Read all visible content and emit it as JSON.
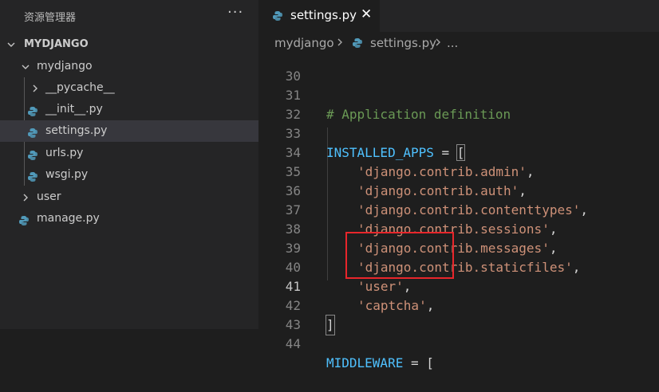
{
  "sidebar": {
    "title": "资源管理器",
    "more_label": "···",
    "project": "MYDJANGO",
    "items": [
      {
        "label": "mydjango",
        "type": "folder"
      },
      {
        "label": "__pycache__",
        "type": "folder"
      },
      {
        "label": "__init__.py",
        "type": "python-file"
      },
      {
        "label": "settings.py",
        "type": "python-file"
      },
      {
        "label": "urls.py",
        "type": "python-file"
      },
      {
        "label": "wsgi.py",
        "type": "python-file"
      },
      {
        "label": "user",
        "type": "folder"
      },
      {
        "label": "manage.py",
        "type": "python-file"
      }
    ]
  },
  "tab": {
    "label": "settings.py",
    "close_label": "✕"
  },
  "breadcrumb": {
    "folder": "mydjango",
    "file": "settings.py",
    "more": "..."
  },
  "editor": {
    "lines": [
      {
        "number": "30",
        "code": ""
      },
      {
        "number": "31",
        "code": "# Application definition"
      },
      {
        "number": "32",
        "code": ""
      },
      {
        "number": "33",
        "code": "INSTALLED_APPS = ["
      },
      {
        "number": "34",
        "code": "'django.contrib.admin',"
      },
      {
        "number": "35",
        "code": "'django.contrib.auth',"
      },
      {
        "number": "36",
        "code": "'django.contrib.contenttypes',"
      },
      {
        "number": "37",
        "code": "'django.contrib.sessions',"
      },
      {
        "number": "38",
        "code": "'django.contrib.messages',"
      },
      {
        "number": "39",
        "code": "'django.contrib.staticfiles',"
      },
      {
        "number": "40",
        "code": "'user',"
      },
      {
        "number": "41",
        "code": "'captcha',"
      },
      {
        "number": "42",
        "code": "]"
      },
      {
        "number": "43",
        "code": ""
      },
      {
        "number": "44",
        "code": "MIDDLEWARE = ["
      }
    ],
    "tokens": {
      "comment": "# Application definition",
      "installed_apps": "INSTALLED_APPS",
      "middleware": "MIDDLEWARE",
      "assign": " = ",
      "open_bracket": "[",
      "close_bracket": "]",
      "comma": ",",
      "apps": [
        "'django.contrib.admin'",
        "'django.contrib.auth'",
        "'django.contrib.contenttypes'",
        "'django.contrib.sessions'",
        "'django.contrib.messages'",
        "'django.contrib.staticfiles'",
        "'user'",
        "'captcha'"
      ]
    }
  },
  "colors": {
    "comment": "#6a9955",
    "variable": "#4fc1ff",
    "string": "#ce9178",
    "highlight_box": "#e8262b",
    "python_icon": "#519aba"
  }
}
